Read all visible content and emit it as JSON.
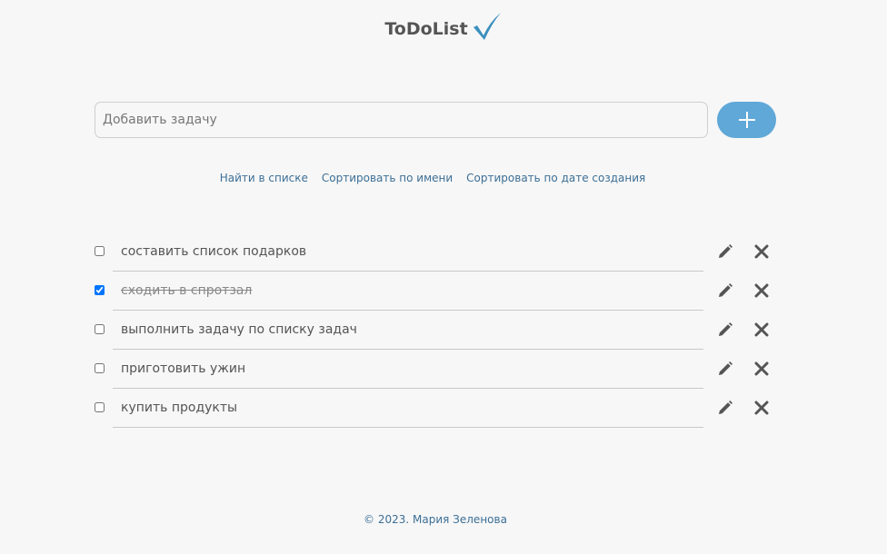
{
  "header": {
    "title": "ToDoList",
    "logo_icon": "checkmark-icon",
    "accent": "#3a8fbf"
  },
  "add_form": {
    "placeholder": "Добавить задачу",
    "value": "",
    "button_icon": "plus-icon",
    "button_color": "#5fa8d8"
  },
  "links": [
    {
      "label": "Найти в списке"
    },
    {
      "label": "Сортировать по имени"
    },
    {
      "label": "Сортировать по дате создания"
    }
  ],
  "tasks": [
    {
      "label": "составить список подарков",
      "done": false
    },
    {
      "label": "сходить в спротзал",
      "done": true
    },
    {
      "label": "выполнить задачу по списку задач",
      "done": false
    },
    {
      "label": "приготовить ужин",
      "done": false
    },
    {
      "label": "купить продукты",
      "done": false
    }
  ],
  "task_actions": {
    "edit_icon": "pencil-icon",
    "delete_icon": "close-icon"
  },
  "footer": {
    "text": "© 2023. Мария Зеленова"
  }
}
